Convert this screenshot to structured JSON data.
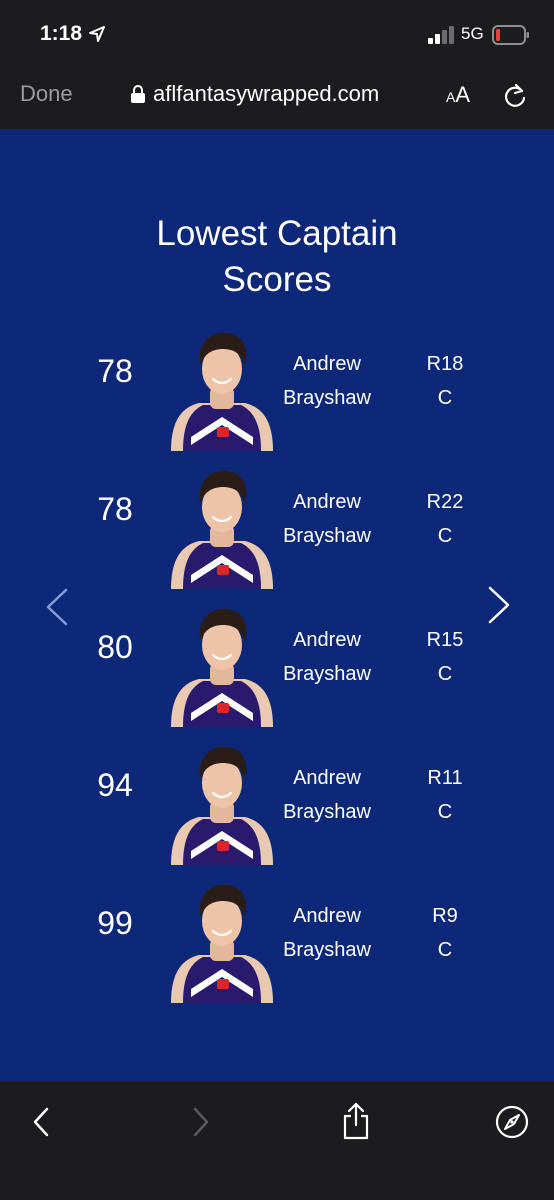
{
  "status": {
    "time": "1:18",
    "network": "5G"
  },
  "browser": {
    "done_label": "Done",
    "url": "aflfantasywrapped.com",
    "text_size_small": "A",
    "text_size_large": "A"
  },
  "page": {
    "title_line1": "Lowest Captain",
    "title_line2": "Scores"
  },
  "entries": [
    {
      "score": "78",
      "first_name": "Andrew",
      "last_name": "Brayshaw",
      "round": "R18",
      "role": "C"
    },
    {
      "score": "78",
      "first_name": "Andrew",
      "last_name": "Brayshaw",
      "round": "R22",
      "role": "C"
    },
    {
      "score": "80",
      "first_name": "Andrew",
      "last_name": "Brayshaw",
      "round": "R15",
      "role": "C"
    },
    {
      "score": "94",
      "first_name": "Andrew",
      "last_name": "Brayshaw",
      "round": "R11",
      "role": "C"
    },
    {
      "score": "99",
      "first_name": "Andrew",
      "last_name": "Brayshaw",
      "round": "R9",
      "role": "C"
    }
  ],
  "colors": {
    "page_background": "#0d2878",
    "chrome_background": "#1c1c1e",
    "jersey_purple": "#2a1a6e",
    "battery_low": "#e5413a"
  },
  "icons": {
    "location": "location-arrow-icon",
    "signal": "cellular-signal-icon",
    "battery": "battery-low-icon",
    "lock": "lock-icon",
    "reload": "reload-icon",
    "prev": "chevron-left-icon",
    "next": "chevron-right-icon",
    "back": "back-icon",
    "forward": "forward-icon",
    "share": "share-icon",
    "safari": "compass-icon"
  }
}
